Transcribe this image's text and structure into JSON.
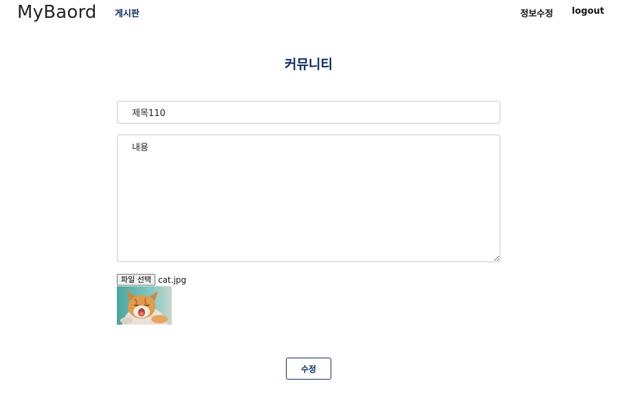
{
  "header": {
    "logo": "MyBaord",
    "nav_board": "게시판",
    "nav_edit_profile": "정보수정",
    "nav_logout": "logout"
  },
  "page": {
    "title": "커뮤니티"
  },
  "form": {
    "title_value": "제목110",
    "content_value": "내용",
    "file_button_label": "파일 선택",
    "file_name": "cat.jpg",
    "preview_alt": "cat.jpg",
    "submit_label": "수정"
  },
  "colors": {
    "accent": "#0a2a66",
    "border": "#c9c9c9"
  }
}
